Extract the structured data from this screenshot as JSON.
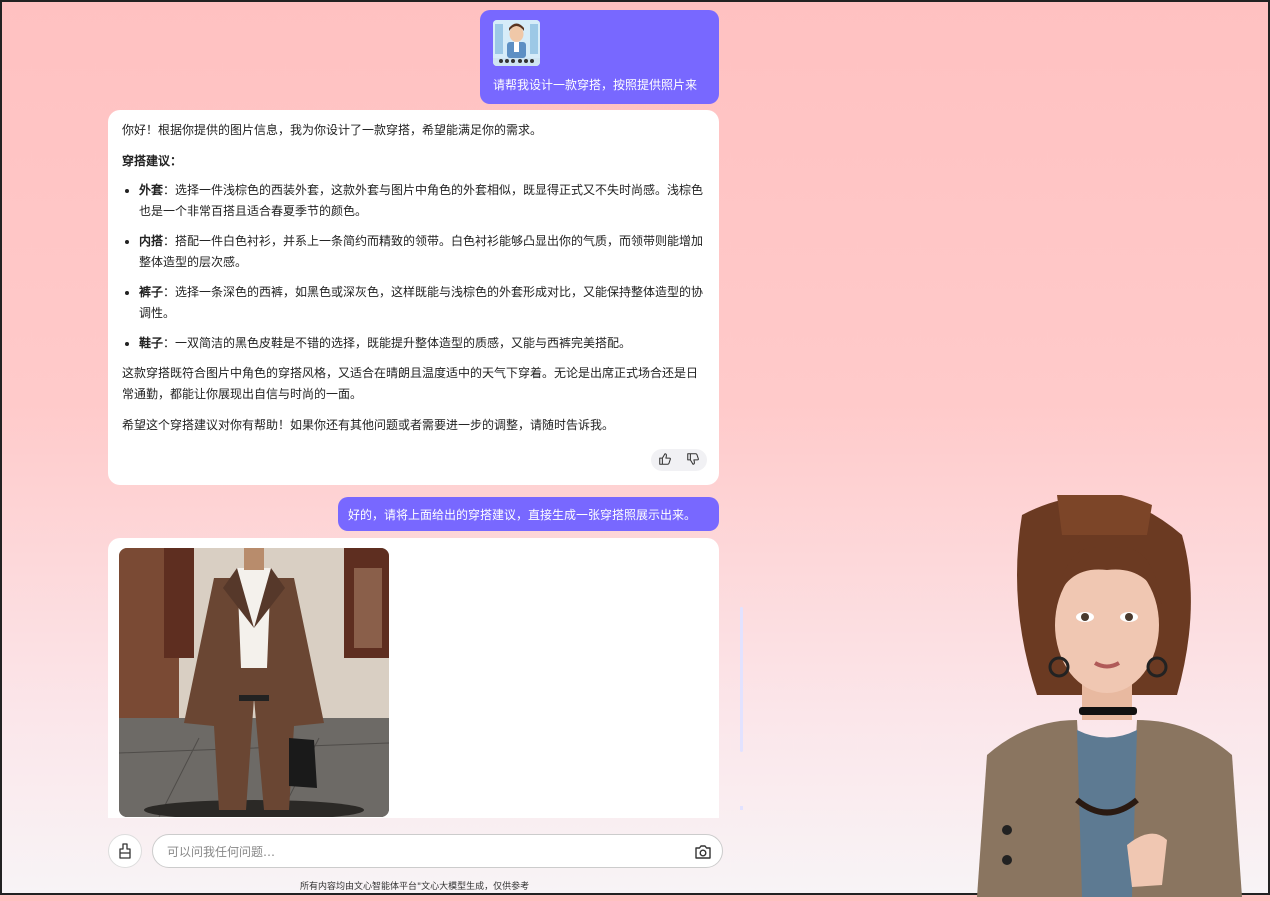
{
  "messages": {
    "user1_text": "请帮我设计一款穿搭，按照提供照片来",
    "bot1": {
      "intro": "你好！根据你提供的图片信息，我为你设计了一款穿搭，希望能满足你的需求。",
      "heading": "穿搭建议：",
      "items": [
        {
          "label": "外套",
          "text": "：选择一件浅棕色的西装外套，这款外套与图片中角色的外套相似，既显得正式又不失时尚感。浅棕色也是一个非常百搭且适合春夏季节的颜色。"
        },
        {
          "label": "内搭",
          "text": "：搭配一件白色衬衫，并系上一条简约而精致的领带。白色衬衫能够凸显出你的气质，而领带则能增加整体造型的层次感。"
        },
        {
          "label": "裤子",
          "text": "：选择一条深色的西裤，如黑色或深灰色，这样既能与浅棕色的外套形成对比，又能保持整体造型的协调性。"
        },
        {
          "label": "鞋子",
          "text": "：一双简洁的黑色皮鞋是不错的选择，既能提升整体造型的质感，又能与西裤完美搭配。"
        }
      ],
      "para2": "这款穿搭既符合图片中角色的穿搭风格，又适合在晴朗且温度适中的天气下穿着。无论是出席正式场合还是日常通勤，都能让你展现出自信与时尚的一面。",
      "para3": "希望这个穿搭建议对你有帮助！如果你还有其他问题或者需要进一步的调整，请随时告诉我。"
    },
    "user2_text": "好的，请将上面给出的穿搭建议，直接生成一张穿搭照展示出来。"
  },
  "composer": {
    "placeholder": "可以问我任何问题…"
  },
  "footer": "所有内容均由文心智能体平台\"文心大模型生成，仅供参考",
  "colors": {
    "user_bubble": "#7868ff",
    "background_top": "#ffc1c1",
    "background_bottom": "#f8f4f6"
  }
}
